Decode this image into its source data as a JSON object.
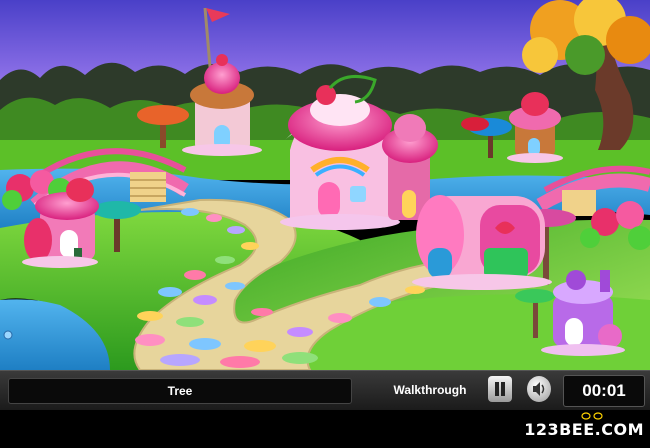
{
  "hud": {
    "item_label": "Tree",
    "walkthrough_label": "Walkthrough",
    "timer": "00:01"
  },
  "branding": {
    "logo_text": "123BEE.COM"
  },
  "icons": {
    "pause": "pause-icon",
    "sound": "speaker-icon"
  },
  "colors": {
    "sky_top": "#5a4bd1",
    "grass": "#4fbf2a",
    "river": "#3aa6e0",
    "path": "#e9d9a8",
    "bridge": "#e8509a",
    "hud_bg": "#262626"
  }
}
